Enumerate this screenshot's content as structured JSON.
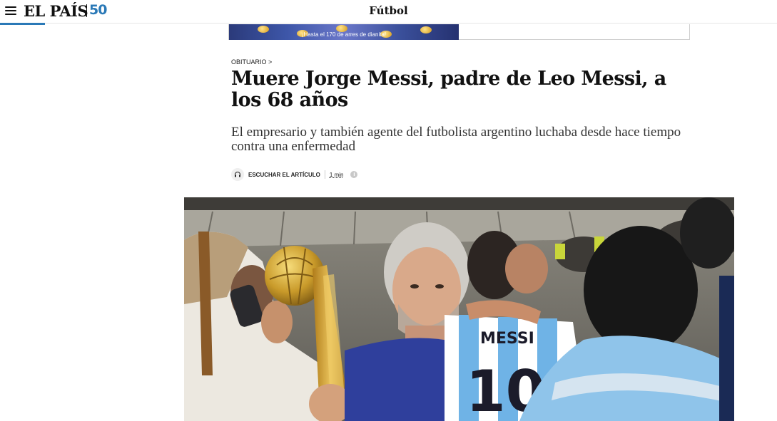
{
  "header": {
    "logo_text": "EL PAÍS",
    "logo_anniversary": "50",
    "section": "Fútbol",
    "accent_color": "#2a79b7"
  },
  "ad": {
    "caption": "¡Hasta el 170 de arres de dianita!"
  },
  "article": {
    "kicker": "OBITUARIO >",
    "headline": "Muere Jorge Messi, padre de Leo Messi, a los 68 años",
    "subtitle": "El empresario y también agente del futbolista argentino luchaba desde hace tiempo contra una enfermedad",
    "listen_label": "ESCUCHAR EL ARTÍCULO",
    "read_time": "1 min",
    "info_glyph": "i"
  },
  "photo": {
    "shirt_name": "MESSI",
    "shirt_number": "10"
  },
  "icons": {
    "menu": "hamburger-menu-icon",
    "headphones": "headphones-icon",
    "info": "info-icon"
  }
}
